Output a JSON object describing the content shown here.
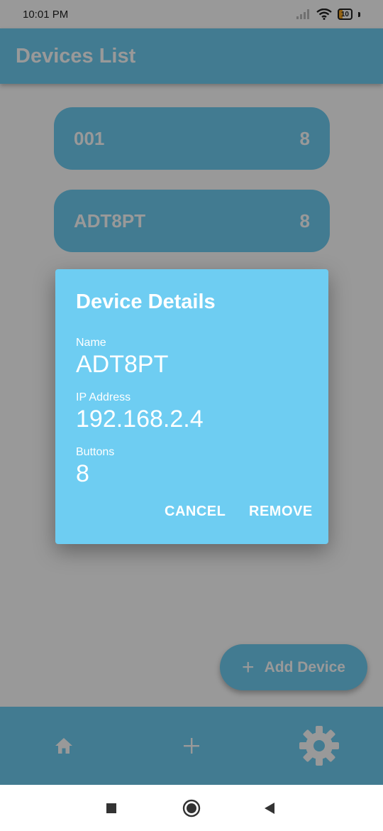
{
  "status_bar": {
    "time": "10:01 PM",
    "battery_level": "10",
    "icons": [
      "signal-icon",
      "wifi-icon",
      "battery-icon"
    ]
  },
  "app_bar": {
    "title": "Devices List"
  },
  "devices": [
    {
      "name": "001",
      "buttons": "8"
    },
    {
      "name": "ADT8PT",
      "buttons": "8"
    }
  ],
  "fab": {
    "label": "Add Device",
    "icon": "plus-icon"
  },
  "bottom_nav": {
    "items": [
      {
        "name": "home",
        "icon": "home-icon"
      },
      {
        "name": "add",
        "icon": "plus-icon"
      },
      {
        "name": "settings",
        "icon": "gear-icon"
      }
    ]
  },
  "dialog": {
    "title": "Device Details",
    "name_label": "Name",
    "name_value": "ADT8PT",
    "ip_label": "IP Address",
    "ip_value": "192.168.2.4",
    "buttons_label": "Buttons",
    "buttons_value": "8",
    "cancel_label": "CANCEL",
    "remove_label": "REMOVE"
  },
  "system_nav": {
    "items": [
      "recents-icon",
      "home-circle-icon",
      "back-icon"
    ]
  },
  "colors": {
    "accent": "#6ecdf2",
    "scrim": "rgba(0,0,0,0.4)",
    "on_accent": "#ffffff"
  }
}
